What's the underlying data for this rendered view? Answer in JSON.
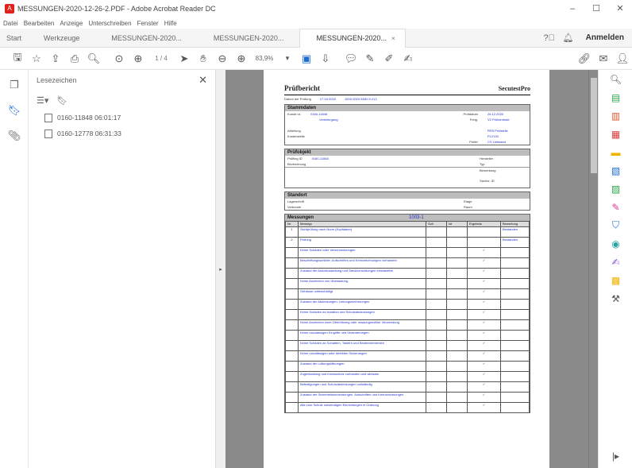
{
  "window": {
    "title": "MESSUNGEN-2020-12-26-2.PDF - Adobe Acrobat Reader DC",
    "minimize": "–",
    "maximize": "☐",
    "close": "✕"
  },
  "menu": [
    "Datei",
    "Bearbeiten",
    "Anzeige",
    "Unterschreiben",
    "Fenster",
    "Hilfe"
  ],
  "tabs": {
    "start": "Start",
    "tools": "Werkzeuge",
    "doc1": "MESSUNGEN-2020...",
    "doc2": "MESSUNGEN-2020...",
    "doc3": "MESSUNGEN-2020...",
    "close": "×",
    "signin": "Anmelden"
  },
  "toolbar": {
    "page_current": "1",
    "page_total": "/ 4",
    "zoom": "83,9%"
  },
  "bookmarks": {
    "title": "Lesezeichen",
    "close": "✕",
    "items": [
      {
        "label": "0160-11848 06:01:17"
      },
      {
        "label": "0160-12778 06:31:33"
      }
    ]
  },
  "document": {
    "title": "Prüfbericht",
    "brand": "SecutestPro",
    "date_label": "Datum der Prüfung",
    "date_value": "27.04.2020",
    "serial_value": "1500.0000.9A50.9.213",
    "sec_master": "Stammdaten",
    "kunde_label": "Kunde nr.",
    "kunde_value": "0160-11848",
    "kunde_sub": "Verteilergang",
    "pruef_label": "Prüfdatum",
    "pruef_value": "26.12.2020",
    "freig_label": "Freig.",
    "freig_value": "V2 Prüfzentrale",
    "abt_label": "Abteilung",
    "kost_label": "Kostenstelle",
    "kost_v1": "RFB Prüfstelle",
    "kost_v2": "PL2130",
    "pruefer_label": "Prüfer",
    "pruefer_value": "CS Leitstand",
    "sec_object": "Prüfobjekt",
    "obj_label": "Prüfling ID",
    "obj_value": "0160-11848",
    "obj_label2": "Bezeichnung",
    "herst_label": "Hersteller",
    "typ_label": "Typ",
    "bem_label": "Bemerkung",
    "sach_label": "Sachnr. ID",
    "sec_location": "Standort",
    "lage_label": "Lagerschrift",
    "verb_label": "Verbunde",
    "etage_label": "Etage",
    "raum_label": "Raum",
    "sec_measure": "Messungen",
    "measure_num": "1003-1",
    "col_nr": "Nr.",
    "col_mess": "Messtyp",
    "col_soll": "Soll",
    "col_ist": "Ist",
    "col_erg": "Ergebnis",
    "col_bew": "Bewertung",
    "rows": [
      {
        "nr": "1",
        "text": "Sichtprüfung nach Norm (Kopfdaten)",
        "erg": "",
        "bew": "Bestanden"
      },
      {
        "nr": "2",
        "text": "Prüfung",
        "erg": "",
        "bew": "Bestanden"
      },
      {
        "nr": "",
        "text": "Keine Schäden oder Verschmutzungen",
        "erg": "✓",
        "bew": ""
      },
      {
        "nr": "",
        "text": "Beschriftungsschilder, Aufschriften und Kennzeichnungen vorhanden",
        "erg": "✓",
        "bew": ""
      },
      {
        "nr": "",
        "text": "Zustand der Anschlussleitung und Steckvorrichtungen einwandfrei",
        "erg": "✓",
        "bew": ""
      },
      {
        "nr": "",
        "text": "Keine Anzeichen von Überlastung",
        "erg": "✓",
        "bew": ""
      },
      {
        "nr": "",
        "text": "Gehäuse unbeschädigt",
        "erg": "✓",
        "bew": ""
      },
      {
        "nr": "",
        "text": "Zustand der Abdeckungen, Leitungseinführungen",
        "erg": "✓",
        "bew": ""
      },
      {
        "nr": "",
        "text": "Keine Schäden an Isolation und Schutzabdeckungen",
        "erg": "✓",
        "bew": ""
      },
      {
        "nr": "",
        "text": "Keine Anzeichen einer Überhitzung oder unsachgemäßer Verwendung",
        "erg": "✓",
        "bew": ""
      },
      {
        "nr": "",
        "text": "Keine unzulässigen Eingriffe und Veränderungen",
        "erg": "✓",
        "bew": ""
      },
      {
        "nr": "",
        "text": "Keine Schäden an Schaltern, Tastern und Bedienelementen",
        "erg": "✓",
        "bew": ""
      },
      {
        "nr": "",
        "text": "Keine unzulässigen oder defekten Sicherungen",
        "erg": "✓",
        "bew": ""
      },
      {
        "nr": "",
        "text": "Zustand der Lüftungsöffnungen",
        "erg": "✓",
        "bew": ""
      },
      {
        "nr": "",
        "text": "Zugentlastung und Knickschutz vorhanden und wirksam",
        "erg": "✓",
        "bew": ""
      },
      {
        "nr": "",
        "text": "Befestigungen und Schutzabdeckungen vollständig",
        "erg": "✓",
        "bew": ""
      },
      {
        "nr": "",
        "text": "Zustand der Sicherheitseinrichtungen, Aufschriften und Kennzeichnungen",
        "erg": "✓",
        "bew": ""
      },
      {
        "nr": "",
        "text": "Alle zum Schutz notwendigen Einrichtungen in Ordnung",
        "erg": "✓",
        "bew": ""
      }
    ]
  }
}
